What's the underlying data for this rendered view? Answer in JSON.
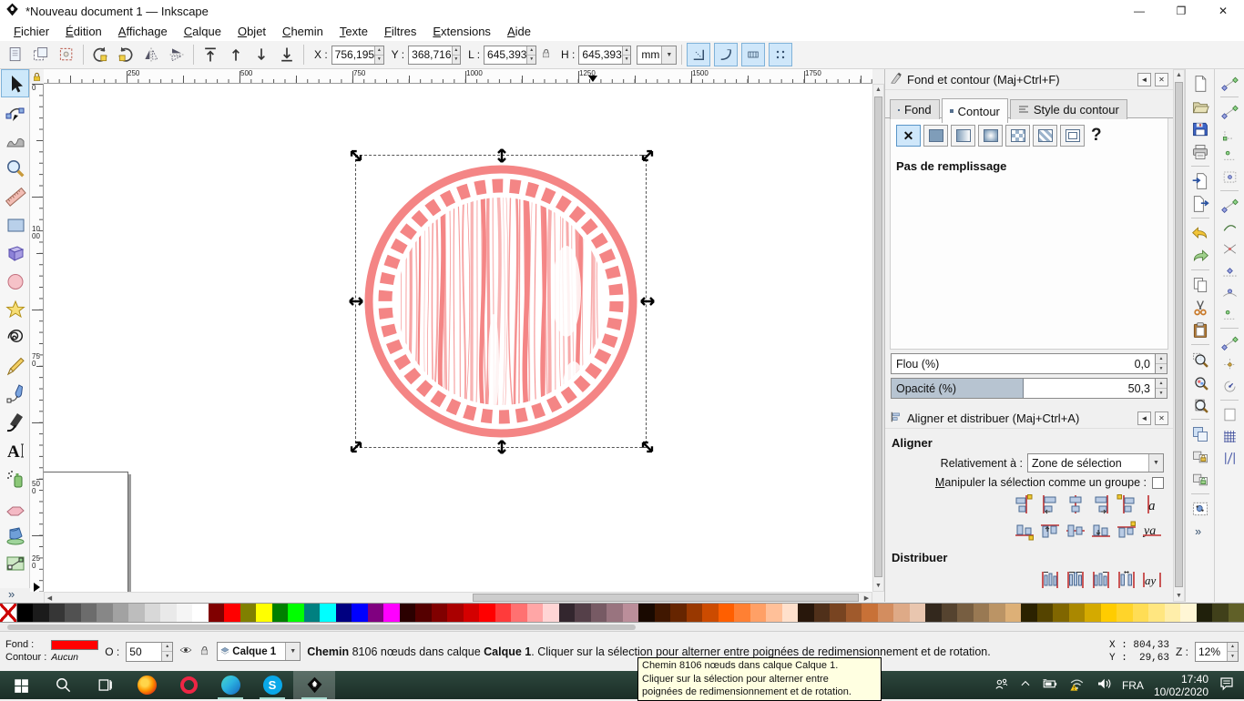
{
  "window": {
    "title": "*Nouveau document 1 — Inkscape",
    "minimize": "—",
    "restore": "❐",
    "close": "✕"
  },
  "menu": {
    "items": [
      "Fichier",
      "Édition",
      "Affichage",
      "Calque",
      "Objet",
      "Chemin",
      "Texte",
      "Filtres",
      "Extensions",
      "Aide"
    ]
  },
  "tool_controls": {
    "buttons": [
      "select-all",
      "select-all-layers",
      "deselect",
      "|",
      "rotate-ccw",
      "rotate-cw",
      "flip-horizontal",
      "flip-vertical",
      "|",
      "raise-to-top",
      "raise",
      "lower",
      "lower-to-bottom",
      "|"
    ],
    "fields": [
      {
        "label": "X :",
        "value": "756,195"
      },
      {
        "label": "Y :",
        "value": "368,716"
      },
      {
        "label": "L :",
        "value": "645,393"
      },
      {
        "label": "H :",
        "value": "645,393"
      }
    ],
    "unit": "mm",
    "toggles": [
      "transform-stroke",
      "transform-corners",
      "transform-gradient",
      "transform-pattern"
    ]
  },
  "toolbox": [
    "selector-tool",
    "node-tool",
    "tweak-tool",
    "zoom-tool",
    "measure-tool",
    "rectangle-tool",
    "box3d-tool",
    "ellipse-tool",
    "star-tool",
    "spiral-tool",
    "pencil-tool",
    "pen-tool",
    "calligraphy-tool",
    "text-tool",
    "spray-tool",
    "eraser-tool",
    "bucket-tool",
    "gradient-tool"
  ],
  "rulers": {
    "top": [
      "250",
      "500",
      "750",
      "1000",
      "1250",
      "1500",
      "1750"
    ],
    "left": [
      "0",
      "1000",
      "750",
      "500",
      "250"
    ]
  },
  "commands": [
    "document-new",
    "document-open",
    "document-save",
    "document-print",
    "|",
    "document-import",
    "document-export",
    "|",
    "edit-undo",
    "edit-redo",
    "|",
    "edit-copy",
    "edit-cut",
    "edit-paste",
    "|",
    "zoom-selection",
    "zoom-drawing",
    "zoom-page",
    "|",
    "edit-duplicate",
    "edit-clone",
    "clone-unlink",
    "|",
    "xml-editor",
    "chevron-more"
  ],
  "snap": [
    "snap-bbox",
    "|",
    "snap-bbox-edges",
    "snap-bbox-corners",
    "snap-bbox-midpoints",
    "snap-bbox-centers",
    "|",
    "snap-nodes",
    "snap-paths",
    "snap-path-intersections",
    "snap-cusp-nodes",
    "snap-smooth-nodes",
    "snap-midpoints",
    "|",
    "snap-others",
    "snap-object-centers",
    "snap-rotation-centers",
    "|",
    "snap-page-border",
    "snap-grids",
    "snap-guides"
  ],
  "fill_stroke": {
    "title": "Fond et contour (Maj+Ctrl+F)",
    "tabs": [
      {
        "label": "Fond",
        "active": false
      },
      {
        "label": "Contour",
        "active": true
      },
      {
        "label": "Style du contour",
        "active": false
      }
    ],
    "modes": [
      "no-paint",
      "flat-color",
      "linear-gradient",
      "radial-gradient",
      "pattern",
      "swatch",
      "unknown"
    ],
    "help": "?",
    "no_fill_text": "Pas de remplissage",
    "blur_label": "Flou (%)",
    "blur_value": "0,0",
    "opacity_label": "Opacité (%)",
    "opacity_value": "50,3",
    "opacity_percent": 50.3
  },
  "align": {
    "title": "Aligner et distribuer (Maj+Ctrl+A)",
    "heading": "Aligner",
    "relative_label": "Relativement à :",
    "relative_value": "Zone de sélection",
    "group_label": "Manipuler la sélection comme un groupe :",
    "row1": [
      "align-right-to-anchor-left",
      "align-left-edges",
      "align-center-horizontal",
      "align-right-edges",
      "align-left-to-anchor-right",
      "text-anchor-horizontal"
    ],
    "row2": [
      "align-bottom-to-anchor-top",
      "align-top-edges",
      "align-center-vertical",
      "align-bottom-edges",
      "align-top-to-anchor-bottom",
      "text-baseline"
    ],
    "distribute_heading": "Distribuer",
    "row3": [
      "distribute-left-edges",
      "distribute-centers-horizontal",
      "distribute-right-edges",
      "distribute-gaps-horizontal",
      "distribute-text-horizontal"
    ]
  },
  "palette": [
    "none",
    "#000000",
    "#1b1b1b",
    "#363636",
    "#515151",
    "#6c6c6c",
    "#878787",
    "#a2a2a2",
    "#bdbdbd",
    "#d8d8d8",
    "#e9e9e9",
    "#f5f5f5",
    "#ffffff",
    "#800000",
    "#ff0000",
    "#808000",
    "#ffff00",
    "#008000",
    "#00ff00",
    "#008080",
    "#00ffff",
    "#000080",
    "#0000ff",
    "#800080",
    "#ff00ff",
    "#2b0000",
    "#550000",
    "#800000",
    "#aa0000",
    "#d40000",
    "#ff0000",
    "#ff3b3b",
    "#ff7171",
    "#ffa6a6",
    "#ffd5d5",
    "#33262e",
    "#554049",
    "#775a64",
    "#99747f",
    "#bb8e9a",
    "#190900",
    "#401700",
    "#662500",
    "#993800",
    "#cc4b00",
    "#ff5f00",
    "#ff8033",
    "#ffa066",
    "#ffc099",
    "#ffe0cc",
    "#28170b",
    "#50301a",
    "#784421",
    "#a05a2c",
    "#c87137",
    "#d38d5f",
    "#deaa87",
    "#e9c6af",
    "#33281d",
    "#55432f",
    "#775e41",
    "#997953",
    "#bb9465",
    "#ddb077",
    "#2b2200",
    "#554400",
    "#806600",
    "#aa8800",
    "#d4aa00",
    "#ffcc00",
    "#ffd42a",
    "#ffdd55",
    "#ffe680",
    "#ffeeaa",
    "#fff6d5",
    "#20200b",
    "#40401a",
    "#606028"
  ],
  "statusbar": {
    "fill_label": "Fond :",
    "fill_color": "#ff0000",
    "stroke_label": "Contour :",
    "stroke_value": "Aucun",
    "opacity_label": "O :",
    "opacity_value": "50",
    "layer_name": "Calque 1",
    "msg_bold1": "Chemin",
    "msg_text1": " 8106 nœuds dans calque ",
    "msg_bold2": "Calque 1",
    "msg_text2": ". Cliquer sur la sélection pour alterner entre poignées de redimensionnement et de rotation.",
    "x_label": "X :",
    "x_value": "804,33",
    "y_label": "Y :",
    "y_value": "29,63",
    "z_label": "Z :",
    "z_value": "12%"
  },
  "tooltip": {
    "lines": [
      "Chemin 8106 nœuds dans calque Calque 1.",
      "Cliquer sur la sélection pour alterner entre",
      "poignées de redimensionnement et de rotation."
    ]
  },
  "canvas": {
    "stamp_color": "#f48585"
  },
  "taskbar": {
    "lang": "FRA",
    "time": "17:40",
    "date": "10/02/2020"
  }
}
